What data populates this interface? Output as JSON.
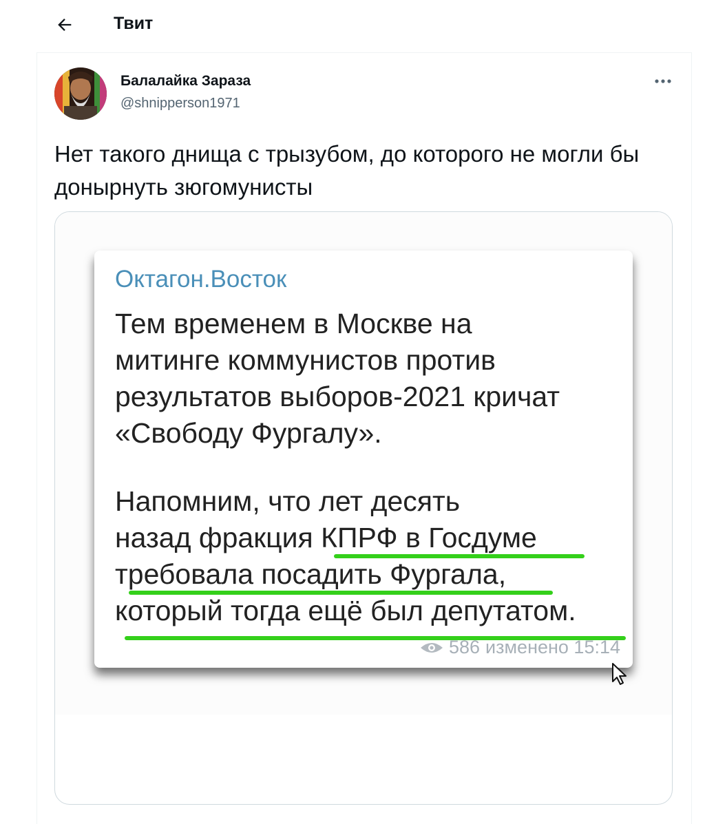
{
  "header": {
    "title": "Твит",
    "back_icon": "arrow-left-icon"
  },
  "tweet": {
    "author": {
      "display_name": "Балалайка Зараза",
      "handle": "@shnipperson1971"
    },
    "text": "Нет такого днища с трызубом, до которого не могли бы донырнуть зюгомунисты",
    "more_icon": "more-horizontal-icon"
  },
  "media": {
    "channel_name": "Октагон.Восток",
    "paragraph_1": "Тем временем в Москве на\nмитинге коммунистов против\nрезультатов выборов-2021 кричат\n«Свободу Фургалу».",
    "paragraph_2": "Напомним, что лет десять\nназад фракция КПРФ в Госдуме\nтребовала посадить Фургала,\nкоторый тогда ещё был депутатом.",
    "views": "586",
    "edited_time": "изменено 15:14",
    "highlight_color": "#34d01a",
    "channel_color": "#4a8fb8"
  }
}
